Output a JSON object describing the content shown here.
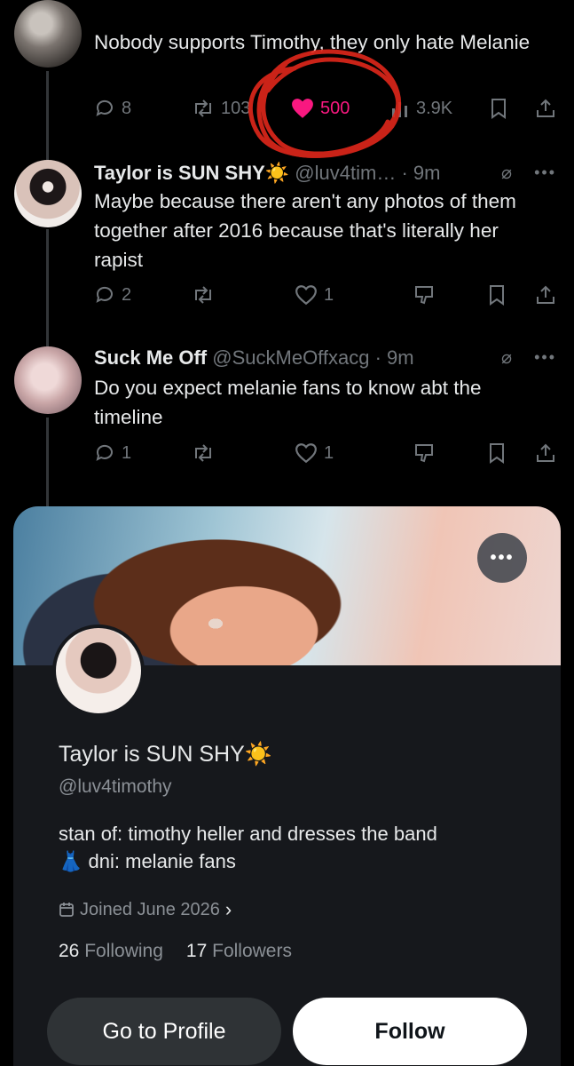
{
  "tweets": [
    {
      "text": "Nobody supports Timothy, they only hate Melanie",
      "replies": "8",
      "retweets": "103",
      "likes": "500",
      "views": "3.9K"
    },
    {
      "name": "Taylor is SUN SHY",
      "name_emoji": "☀️",
      "handle": "@luv4tim…",
      "time": "· 9m",
      "text": "Maybe because there aren't any photos of them together after 2016 because that's literally her rapist",
      "replies": "2",
      "retweets": "",
      "likes": "1"
    },
    {
      "name": "Suck Me Off",
      "handle": "@SuckMeOffxacg",
      "time": "· 9m",
      "text": "Do you expect melanie fans to know abt the timeline",
      "replies": "1",
      "retweets": "",
      "likes": "1"
    }
  ],
  "profile_card": {
    "name": "Taylor is SUN SHY",
    "name_emoji": "☀️",
    "handle": "@luv4timothy",
    "bio_line1": "stan of: timothy heller and dresses the band",
    "bio_line2_emoji": "👗",
    "bio_line2": "dni: melanie fans",
    "joined": "Joined June 2026",
    "following_count": "26",
    "following_label": "Following",
    "followers_count": "17",
    "followers_label": "Followers",
    "more_label": "•••",
    "go_to_profile": "Go to Profile",
    "follow": "Follow"
  },
  "icons": {
    "reply": "reply-icon",
    "retweet": "retweet-icon",
    "like": "heart-icon",
    "views": "views-icon",
    "bookmark": "bookmark-icon",
    "share": "share-icon",
    "grok": "grok-icon",
    "more": "more-icon",
    "calendar": "calendar-icon"
  },
  "colors": {
    "like_pink": "#f91880",
    "scribble_red": "#e0271b"
  }
}
